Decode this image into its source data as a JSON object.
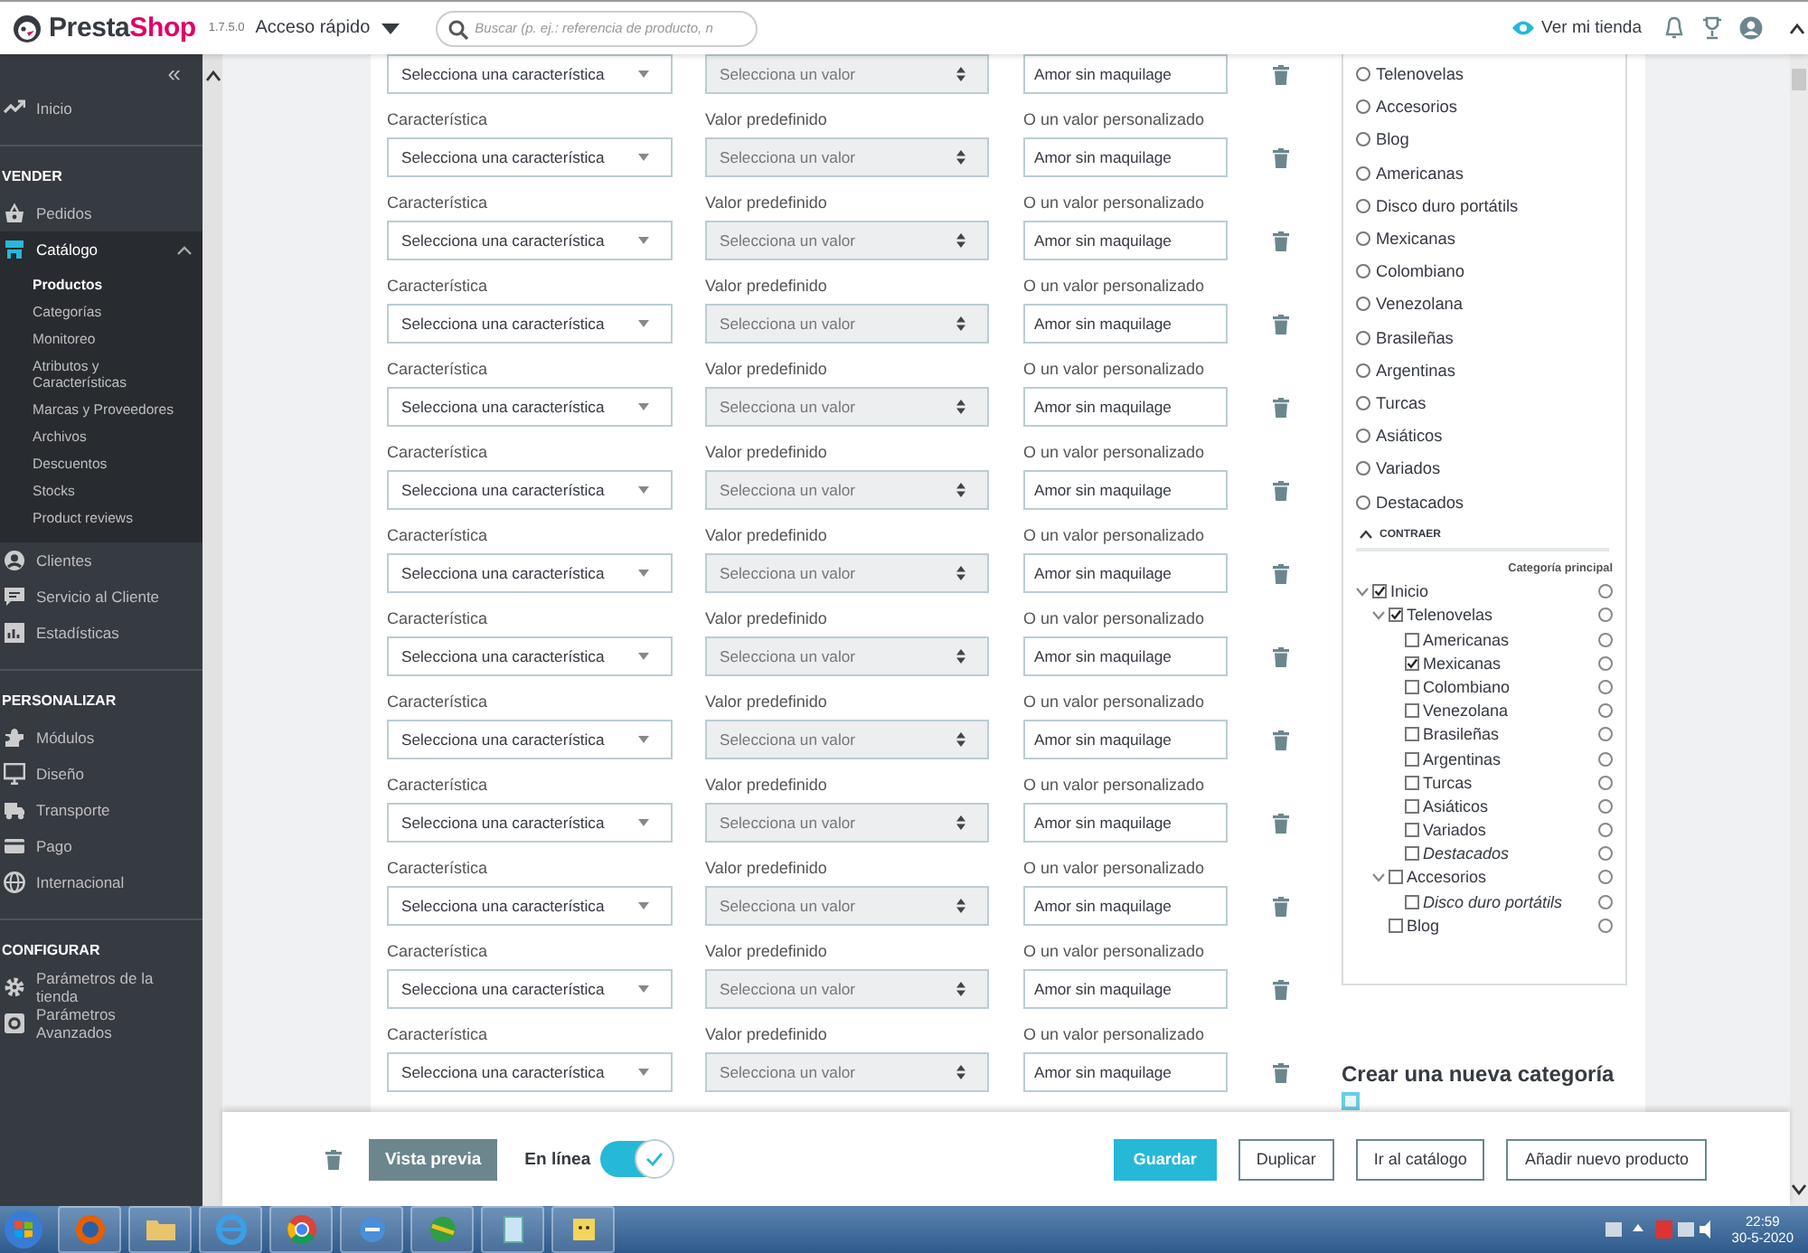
{
  "header": {
    "logo_main": "Presta",
    "logo_accent": "Shop",
    "version": "1.7.5.0",
    "quick_access": "Acceso rápido",
    "search": {
      "placeholder": "Buscar (p. ej.: referencia de producto, n"
    },
    "view_store": "Ver mi tienda"
  },
  "sidebar": {
    "collapse": "«",
    "items": [
      {
        "kind": "link",
        "label": "Inicio",
        "selected": false
      },
      {
        "kind": "section",
        "label": "VENDER"
      },
      {
        "kind": "link",
        "label": "Pedidos",
        "selected": false
      },
      {
        "kind": "link",
        "label": "Catálogo",
        "selected": true,
        "expanded": true,
        "children": [
          {
            "label": "Productos",
            "selected": true
          },
          {
            "label": "Categorías",
            "selected": false
          },
          {
            "label": "Monitoreo",
            "selected": false
          },
          {
            "label": "Atributos y Características",
            "selected": false
          },
          {
            "label": "Marcas y Proveedores",
            "selected": false
          },
          {
            "label": "Archivos",
            "selected": false
          },
          {
            "label": "Descuentos",
            "selected": false
          },
          {
            "label": "Stocks",
            "selected": false
          },
          {
            "label": "Product reviews",
            "selected": false
          }
        ]
      },
      {
        "kind": "link",
        "label": "Clientes",
        "selected": false
      },
      {
        "kind": "link",
        "label": "Servicio al Cliente",
        "selected": false
      },
      {
        "kind": "link",
        "label": "Estadísticas",
        "selected": false
      },
      {
        "kind": "section",
        "label": "PERSONALIZAR"
      },
      {
        "kind": "link",
        "label": "Módulos",
        "selected": false
      },
      {
        "kind": "link",
        "label": "Diseño",
        "selected": false
      },
      {
        "kind": "link",
        "label": "Transporte",
        "selected": false
      },
      {
        "kind": "link",
        "label": "Pago",
        "selected": false
      },
      {
        "kind": "link",
        "label": "Internacional",
        "selected": false
      },
      {
        "kind": "section",
        "label": "CONFIGURAR"
      },
      {
        "kind": "link",
        "label": "Parámetros de la tienda",
        "selected": false
      },
      {
        "kind": "link",
        "label": "Parámetros Avanzados",
        "selected": false
      }
    ]
  },
  "features": {
    "rows": [
      {
        "feature": "Selecciona una característica",
        "value": "Selecciona un valor",
        "value_disabled": true,
        "custom": "Amor sin maquilage"
      },
      {
        "label_feature": "Característica",
        "feature": "Selecciona una característica",
        "label_value": "Valor predefinido",
        "value": "Selecciona un valor",
        "value_disabled": true,
        "label_custom": "O un valor personalizado",
        "custom": "Amor sin maquilage"
      },
      {
        "label_feature": "Característica",
        "feature": "Selecciona una característica",
        "label_value": "Valor predefinido",
        "value": "Selecciona un valor",
        "value_disabled": true,
        "label_custom": "O un valor personalizado",
        "custom": "Amor sin maquilage"
      },
      {
        "label_feature": "Característica",
        "feature": "Selecciona una característica",
        "label_value": "Valor predefinido",
        "value": "Selecciona un valor",
        "value_disabled": true,
        "label_custom": "O un valor personalizado",
        "custom": "Amor sin maquilage"
      },
      {
        "label_feature": "Característica",
        "feature": "Selecciona una característica",
        "label_value": "Valor predefinido",
        "value": "Selecciona un valor",
        "value_disabled": true,
        "label_custom": "O un valor personalizado",
        "custom": "Amor sin maquilage"
      },
      {
        "label_feature": "Característica",
        "feature": "Selecciona una característica",
        "label_value": "Valor predefinido",
        "value": "Selecciona un valor",
        "value_disabled": true,
        "label_custom": "O un valor personalizado",
        "custom": "Amor sin maquilage"
      },
      {
        "label_feature": "Característica",
        "feature": "Selecciona una característica",
        "label_value": "Valor predefinido",
        "value": "Selecciona un valor",
        "value_disabled": true,
        "label_custom": "O un valor personalizado",
        "custom": "Amor sin maquilage"
      },
      {
        "label_feature": "Característica",
        "feature": "Selecciona una característica",
        "label_value": "Valor predefinido",
        "value": "Selecciona un valor",
        "value_disabled": true,
        "label_custom": "O un valor personalizado",
        "custom": "Amor sin maquilage"
      },
      {
        "label_feature": "Característica",
        "feature": "Selecciona una característica",
        "label_value": "Valor predefinido",
        "value": "Selecciona un valor",
        "value_disabled": true,
        "label_custom": "O un valor personalizado",
        "custom": "Amor sin maquilage"
      },
      {
        "label_feature": "Característica",
        "feature": "Selecciona una característica",
        "label_value": "Valor predefinido",
        "value": "Selecciona un valor",
        "value_disabled": true,
        "label_custom": "O un valor personalizado",
        "custom": "Amor sin maquilage"
      },
      {
        "label_feature": "Característica",
        "feature": "Selecciona una característica",
        "label_value": "Valor predefinido",
        "value": "Selecciona un valor",
        "value_disabled": true,
        "label_custom": "O un valor personalizado",
        "custom": "Amor sin maquilage"
      },
      {
        "label_feature": "Característica",
        "feature": "Selecciona una característica",
        "label_value": "Valor predefinido",
        "value": "Selecciona un valor",
        "value_disabled": true,
        "label_custom": "O un valor personalizado",
        "custom": "Amor sin maquilage"
      },
      {
        "label_feature": "Característica",
        "feature": "Selecciona una característica",
        "label_value": "Valor predefinido",
        "value": "Selecciona un valor",
        "value_disabled": true,
        "label_custom": "O un valor personalizado",
        "custom": "Amor sin maquilage"
      }
    ]
  },
  "categories": {
    "radios": [
      {
        "label": "Telenovelas",
        "selected": false
      },
      {
        "label": "Accesorios",
        "selected": false
      },
      {
        "label": "Blog",
        "selected": false
      },
      {
        "label": "Americanas",
        "selected": false
      },
      {
        "label": "Disco duro portátils",
        "selected": false
      },
      {
        "label": "Mexicanas",
        "selected": false
      },
      {
        "label": "Colombiano",
        "selected": false
      },
      {
        "label": "Venezolana",
        "selected": false
      },
      {
        "label": "Brasileñas",
        "selected": false
      },
      {
        "label": "Argentinas",
        "selected": false
      },
      {
        "label": "Turcas",
        "selected": false
      },
      {
        "label": "Asiáticos",
        "selected": false
      },
      {
        "label": "Variados",
        "selected": false
      },
      {
        "label": "Destacados",
        "selected": false
      }
    ],
    "collapse_label": "CONTRAER",
    "tree_heading": "Categoría principal",
    "tree": [
      {
        "label": "Inicio",
        "checked": true,
        "main": false,
        "active": true,
        "expanded": true,
        "children": [
          {
            "label": "Telenovelas",
            "checked": true,
            "main": false,
            "active": true,
            "expanded": true,
            "children": [
              {
                "label": "Americanas",
                "checked": false,
                "main": false,
                "active": true
              },
              {
                "label": "Mexicanas",
                "checked": true,
                "main": false,
                "active": true
              },
              {
                "label": "Colombiano",
                "checked": false,
                "main": false,
                "active": true
              },
              {
                "label": "Venezolana",
                "checked": false,
                "main": false,
                "active": true
              },
              {
                "label": "Brasileñas",
                "checked": false,
                "main": false,
                "active": true
              },
              {
                "label": "Argentinas",
                "checked": false,
                "main": false,
                "active": true
              },
              {
                "label": "Turcas",
                "checked": false,
                "main": false,
                "active": true
              },
              {
                "label": "Asiáticos",
                "checked": false,
                "main": false,
                "active": true
              },
              {
                "label": "Variados",
                "checked": false,
                "main": false,
                "active": true
              },
              {
                "label": "Destacados",
                "checked": false,
                "main": false,
                "active": false
              }
            ]
          },
          {
            "label": "Accesorios",
            "checked": false,
            "main": false,
            "active": true,
            "expanded": true,
            "children": [
              {
                "label": "Disco duro portátils",
                "checked": false,
                "main": false,
                "active": false
              }
            ]
          },
          {
            "label": "Blog",
            "checked": false,
            "main": false,
            "active": true
          }
        ]
      }
    ],
    "new_category_title": "Crear una nueva categoría"
  },
  "footer": {
    "preview": "Vista previa",
    "online": {
      "label": "En línea",
      "on": true
    },
    "buttons": [
      {
        "label": "Guardar",
        "kind": "primary"
      },
      {
        "label": "Duplicar",
        "kind": "outline"
      },
      {
        "label": "Ir al catálogo",
        "kind": "outline"
      },
      {
        "label": "Añadir nuevo producto",
        "kind": "outline"
      }
    ]
  },
  "taskbar": {
    "time": "22:59",
    "date": "30-5-2020"
  }
}
